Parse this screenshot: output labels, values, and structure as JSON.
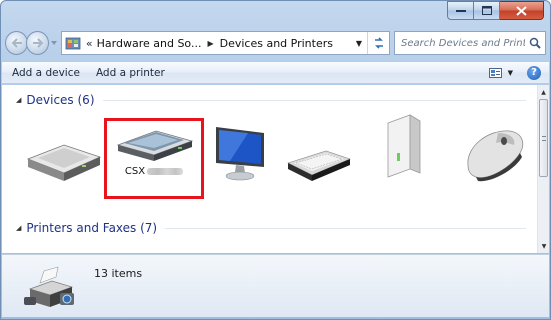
{
  "address_bar": {
    "overflow_chevron": "«",
    "segments": [
      "Hardware and So...",
      "Devices and Printers"
    ]
  },
  "search": {
    "placeholder": "Search Devices and Printers"
  },
  "toolbar": {
    "add_device": "Add a device",
    "add_printer": "Add a printer"
  },
  "groups": {
    "devices": {
      "title": "Devices (6)"
    },
    "printers": {
      "title": "Printers and Faxes (7)"
    }
  },
  "devices": [
    {
      "icon": "external-drive-icon",
      "label": ""
    },
    {
      "icon": "scanner-icon",
      "label": "CSX"
    },
    {
      "icon": "monitor-icon",
      "label": ""
    },
    {
      "icon": "keyboard-icon",
      "label": ""
    },
    {
      "icon": "tower-drive-icon",
      "label": ""
    },
    {
      "icon": "mouse-icon",
      "label": ""
    }
  ],
  "selection_color": "#e8141b",
  "details": {
    "item_count": "13 items"
  }
}
